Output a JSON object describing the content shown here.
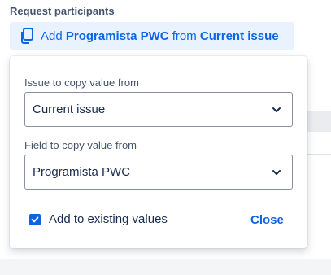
{
  "section": {
    "label": "Request participants"
  },
  "action": {
    "prefix": "Add",
    "field_name": "Programista PWC",
    "middle": "from",
    "source": "Current issue",
    "icon": "copy-icon",
    "color": "#0c66e4"
  },
  "popup": {
    "issue_label": "Issue to copy value from",
    "issue_value": "Current issue",
    "field_label": "Field to copy value from",
    "field_value": "Programista PWC",
    "checkbox_label": "Add to existing values",
    "checkbox_checked": true,
    "close_label": "Close"
  }
}
